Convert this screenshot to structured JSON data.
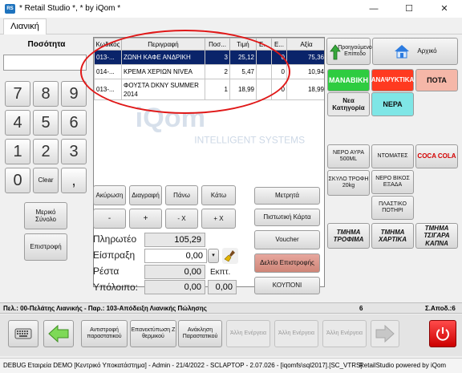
{
  "window": {
    "title": "* Retail Studio *, * by iQom *",
    "minimize": "—",
    "maximize": "☐",
    "close": "✕"
  },
  "tabs": [
    "Λιανική"
  ],
  "left": {
    "qty_label": "Ποσότητα",
    "qty_value": "",
    "keys": [
      "7",
      "8",
      "9",
      "4",
      "5",
      "6",
      "1",
      "2",
      "3",
      "0",
      "Clear",
      ","
    ],
    "btn_mid": "Μερικό Σύνολο",
    "btn_return": "Επιστροφή"
  },
  "grid": {
    "columns": [
      "Κωδικός",
      "Περιγραφή",
      "Ποσ...",
      "Τιμή",
      "Ε...",
      "Ε...",
      "Αξία"
    ],
    "rows": [
      {
        "code": "013-...",
        "desc": "ΖΩΝΗ ΚΑΦΕ ΑΝΔΡΙΚΗ",
        "qty": "3",
        "price": "25,12",
        "e1": "",
        "e2": "0",
        "value": "75,36"
      },
      {
        "code": "014-...",
        "desc": "ΚΡΕΜΑ ΧΕΡΙΩΝ NIVEA",
        "qty": "2",
        "price": "5,47",
        "e1": "",
        "e2": "0",
        "value": "10,94"
      },
      {
        "code": "013-...",
        "desc": "ΦΟΥΣΤΑ DKNY SUMMER 2014",
        "qty": "1",
        "price": "18,99",
        "e1": "",
        "e2": "0",
        "value": "18,99"
      }
    ],
    "watermark_brand": "iQom",
    "watermark_sub": "INTELLIGENT SYSTEMS"
  },
  "actions": {
    "row1": [
      "Ακύρωση",
      "Διαγραφή",
      "Πάνω",
      "Κάτω"
    ],
    "row2": [
      "-",
      "+",
      "- X",
      "+ X"
    ]
  },
  "totals": {
    "payable_label": "Πληρωτέο",
    "payable": "105,29",
    "received_label": "Είσπραξη",
    "received": "0,00",
    "change_label": "Ρέστα",
    "change": "0,00",
    "discount_label": "Εκπτ.",
    "balance_label": "Υπόλοιπο:",
    "balance": "0,00",
    "discount": "0,00"
  },
  "payments": [
    "Μετρητά",
    "Πιστωτική Κάρτα",
    "Voucher",
    "Δελτίο Επιστροφής",
    "ΚΟΥΠΟΝΙ"
  ],
  "right": {
    "prev_level": "Προηγούμενο Επίπεδο",
    "home": "Αρχικό",
    "categories": [
      {
        "label": "ΜΑΝΑΒΙΚΗ",
        "color": "#2ecc40"
      },
      {
        "label": "ΑΝΑΨΥΚΤΙΚΑ",
        "color": "#ff3a20"
      },
      {
        "label": "ΠΟΤΑ",
        "color": "#f5b7a8"
      },
      {
        "label": "Νεα Κατηγορία",
        "color": "#e8e8e8"
      },
      {
        "label": "ΝΕΡΑ",
        "color": "#7fe6e6"
      }
    ],
    "products": [
      {
        "label": "ΝΕΡΟ ΑΥΡΑ 500ML"
      },
      {
        "label": "ΝΤΟΜΑΤΕΣ"
      },
      {
        "label": "COCA COLA"
      },
      {
        "label": "ΣΚΥΛΟ ΤΡΟΦΗ 20kg"
      },
      {
        "label": "ΝΕΡΟ ΒΙΚΟΣ ΕΞΑΔΑ"
      },
      {
        "label": "ΠΛΑΣΤΙΚΟ ΠΟΤΗΡΙ"
      }
    ],
    "departments": [
      "ΤΜΗΜΑ ΤΡΟΦΙΜΑ",
      "ΤΜΗΜΑ ΧΑΡΤΙΚΑ",
      "ΤΜΗΜΑ ΤΣΙΓΑΡΑ ΚΑΠΝΑ"
    ]
  },
  "status": {
    "text": "Πελ.: 00-Πελάτης Λιανικής - Παρ.: 103-Απόδειξη Λιανικής Πώλησης",
    "count": "6",
    "receipts": "Σ.Αποδ.:6"
  },
  "bottom": {
    "reverse": "Αντιστροφή παραστατικού",
    "reprint": "Επανεκτύπωση Ζ θερμικού",
    "recall": "Ανάκληση Παραστατικού",
    "other1": "Άλλη Ενέργεια",
    "other2": "Άλλη Ενέργεια",
    "other3": "Άλλη Ενέργεια"
  },
  "footer": {
    "left": "DEBUG Εταιρεία DEMO [Κεντρικό Υποκατάστημα] - Admin - 21/4/2022 - SCLAPTOP - 2.07.026 - [iqomfs\\sql2017].[SC_VTRS]",
    "right": "RetailStudio powered by iQom"
  },
  "colors": {
    "accent": "#0a246a",
    "annotation": "#e01818",
    "dept_text": "#cc0000"
  }
}
